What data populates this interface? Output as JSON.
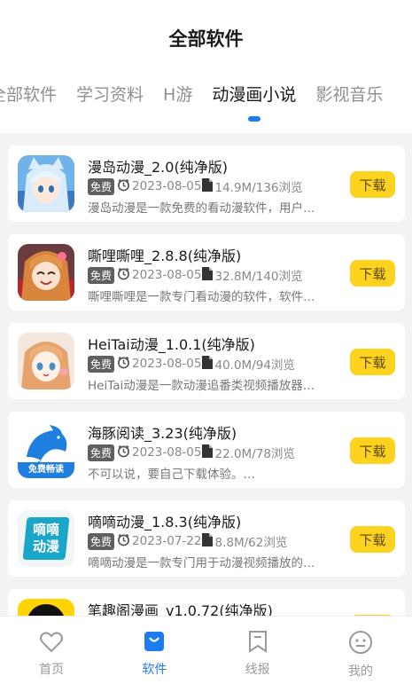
{
  "header": {
    "title": "全部软件",
    "tabs": [
      "全部软件",
      "学习资料",
      "H游",
      "动漫画小说",
      "影视音乐"
    ],
    "active_tab": "动漫画小说"
  },
  "apps": [
    {
      "name": "漫岛动漫_2.0(纯净版)",
      "badge": "免费",
      "date": "2023-08-05",
      "stats": "14.9M/136浏览",
      "desc": "漫岛动漫是一款免费的看动漫软件，用户…",
      "button": "下载",
      "icon": "anime-girl-icon"
    },
    {
      "name": "嘶哩嘶哩_2.8.8(纯净版)",
      "badge": "免费",
      "date": "2023-08-05",
      "stats": "32.8M/140浏览",
      "desc": "嘶哩嘶哩是一款专门看动漫的软件，软件…",
      "button": "下载",
      "icon": "anime-girl-icon"
    },
    {
      "name": "HeiTai动漫_1.0.1(纯净版)",
      "badge": "免费",
      "date": "2023-08-05",
      "stats": "40.0M/94浏览",
      "desc": "HeiTai动漫是一款动漫追番类视频播放器…",
      "button": "下载",
      "icon": "anime-girl-icon"
    },
    {
      "name": "海豚阅读_3.23(纯净版)",
      "badge": "免费",
      "date": "2023-08-05",
      "stats": "22.0M/78浏览",
      "desc": "不可以说，要自己下载体验。…",
      "button": "下载",
      "icon": "dolphin-icon",
      "icon_caption": "免费畅读"
    },
    {
      "name": "嘀嘀动漫_1.8.3(纯净版)",
      "badge": "免费",
      "date": "2023-07-22",
      "stats": "8.8M/62浏览",
      "desc": "嘀嘀动漫是一款专门用于动漫视频播放的…",
      "button": "下载",
      "icon": "text-logo-icon",
      "icon_text": "嘀嘀动漫"
    },
    {
      "name": "笔趣阁漫画_v1.0.72(纯净版)",
      "button": "下载",
      "icon": "app-icon"
    }
  ],
  "nav": [
    {
      "label": "首页",
      "icon": "heart-icon"
    },
    {
      "label": "软件",
      "icon": "bag-icon",
      "active": true
    },
    {
      "label": "线报",
      "icon": "bookmark-icon"
    },
    {
      "label": "我的",
      "icon": "face-icon"
    }
  ],
  "colors": {
    "accent": "#1e7cf2",
    "download": "#ffd21f",
    "badge": "#5f5f5f"
  }
}
